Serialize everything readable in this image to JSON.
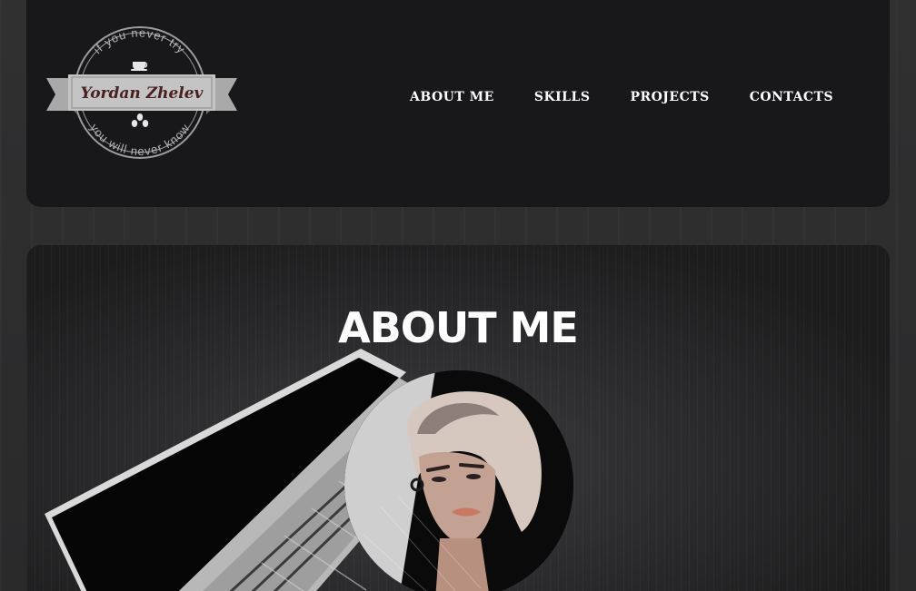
{
  "logo": {
    "name": "Yordan Zhelev",
    "top_text": "if you never try",
    "bottom_text": "you will never know"
  },
  "nav": {
    "items": [
      {
        "label": "ABOUT ME"
      },
      {
        "label": "SKILLS"
      },
      {
        "label": "PROJECTS"
      },
      {
        "label": "CONTACTS"
      }
    ]
  },
  "about": {
    "title": "ABOUT ME"
  },
  "colors": {
    "header_bg": "#18181a",
    "page_bg": "#2c2c2d",
    "text": "#ffffff",
    "ribbon": "#bdbdbd"
  },
  "icons": [
    "coffee-cup-icon",
    "coffee-beans-icon"
  ]
}
